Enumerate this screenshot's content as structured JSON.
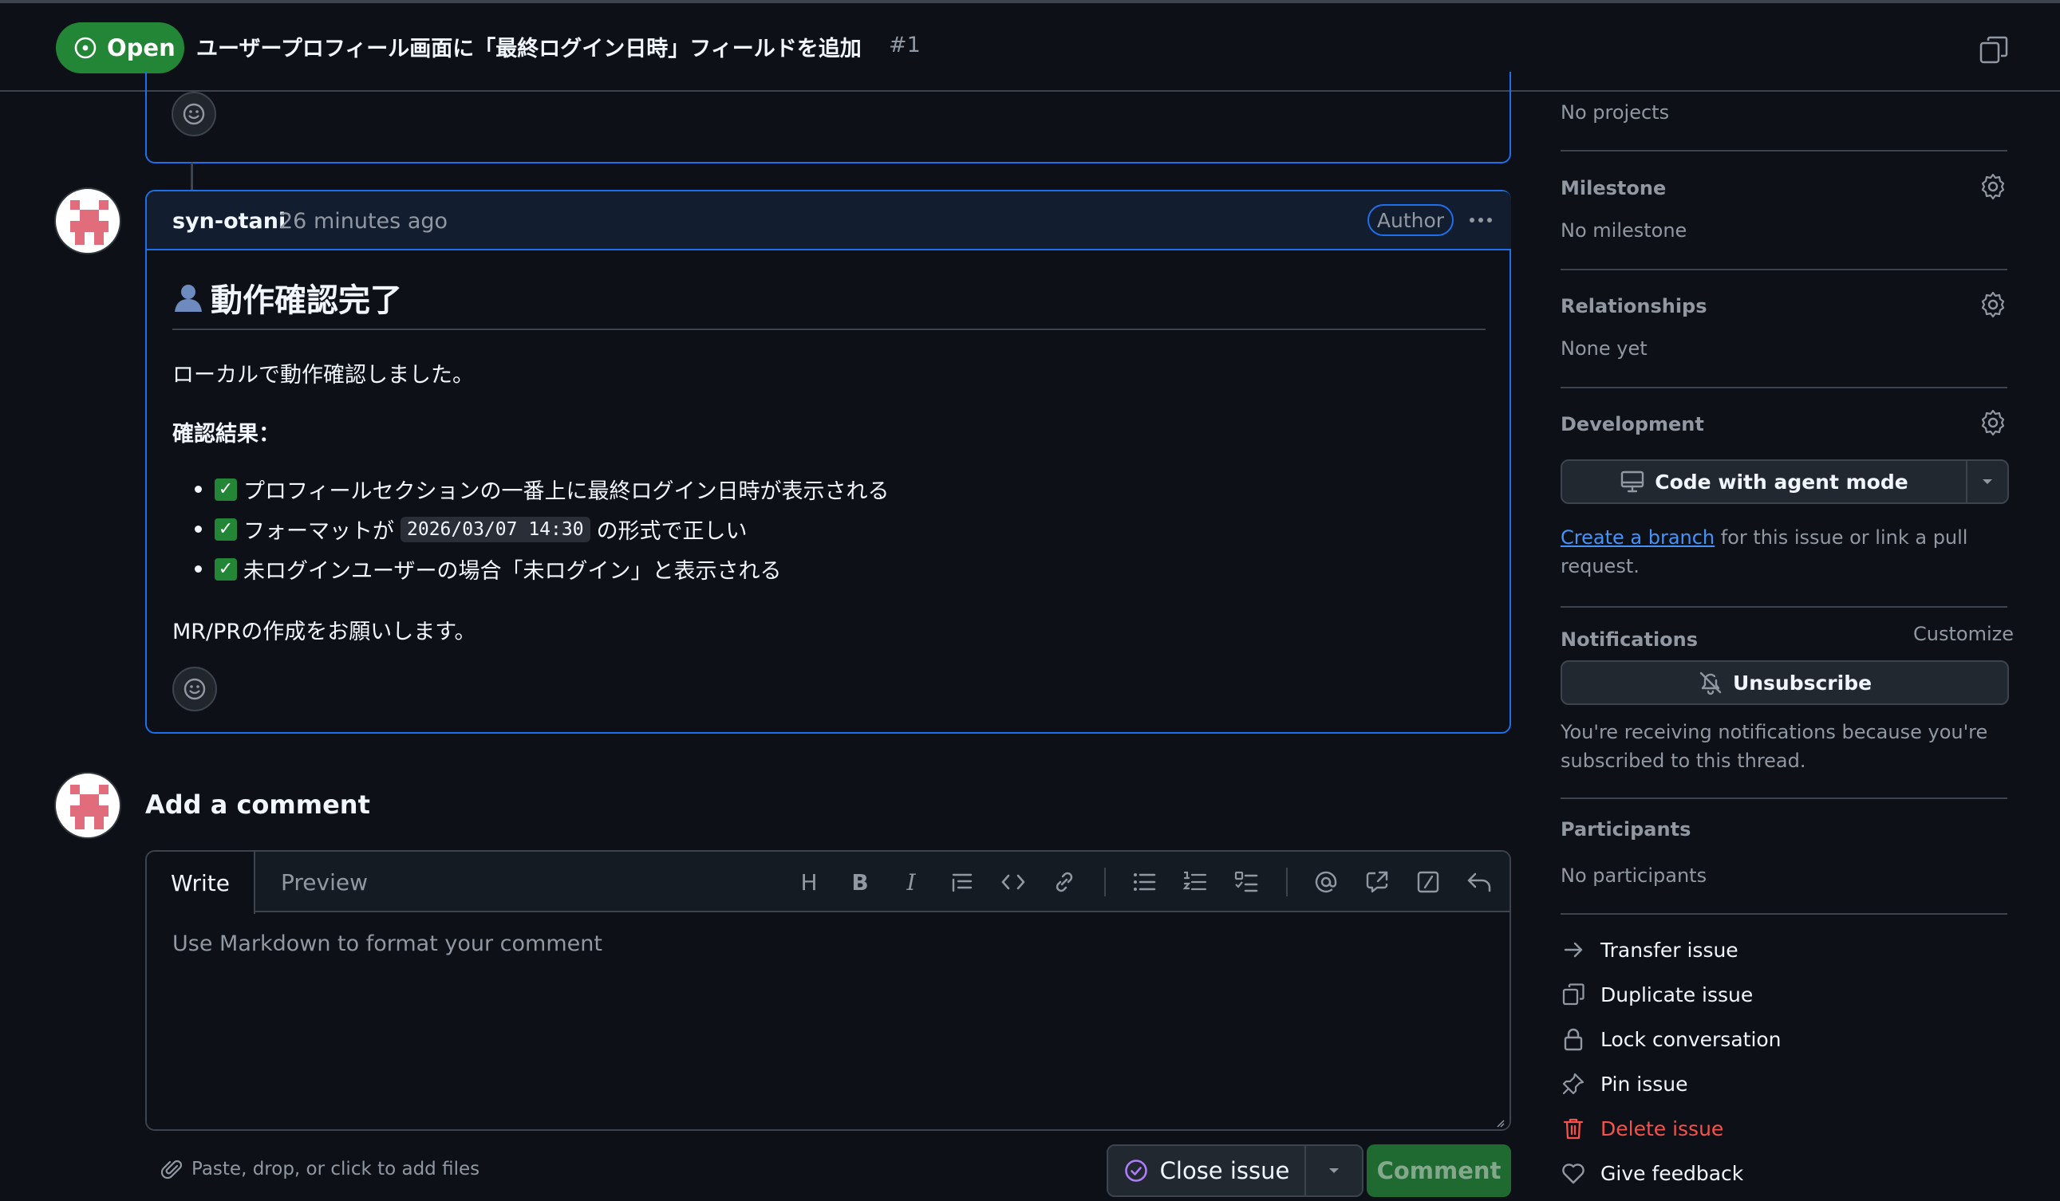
{
  "header": {
    "status": "Open",
    "title": "ユーザープロフィール画面に「最終ログイン日時」フィールドを追加",
    "number": "#1"
  },
  "comment": {
    "user": "syn-otani",
    "time": "26 minutes ago",
    "badge": "Author",
    "heading": "動作確認完了",
    "p1": "ローカルで動作確認しました。",
    "result_label": "確認結果：",
    "items": [
      {
        "text": "プロフィールセクションの一番上に最終ログイン日時が表示される"
      },
      {
        "before": "フォーマットが",
        "code": "2026/03/07 14:30",
        "after": "の形式で正しい"
      },
      {
        "text": "未ログインユーザーの場合「未ログイン」と表示される"
      }
    ],
    "closing": "MR/PRの作成をお願いします。"
  },
  "add_comment": {
    "title": "Add a comment",
    "tab_write": "Write",
    "tab_preview": "Preview",
    "toolbar_heading": "H",
    "toolbar_bold": "B",
    "toolbar_italic": "I",
    "placeholder": "Use Markdown to format your comment",
    "attach": "Paste, drop, or click to add files",
    "close_issue": "Close issue",
    "comment": "Comment"
  },
  "sidebar": {
    "projects_value": "No projects",
    "milestone_label": "Milestone",
    "milestone_value": "No milestone",
    "relationships_label": "Relationships",
    "relationships_value": "None yet",
    "development_label": "Development",
    "agent_button": "Code with agent mode",
    "branch_link": "Create a branch",
    "branch_text_1": " for this issue or link a pull",
    "branch_text_2": "request.",
    "notifications_label": "Notifications",
    "customize": "Customize",
    "unsubscribe": "Unsubscribe",
    "notif_text_1": "You're receiving notifications because you're",
    "notif_text_2": "subscribed to this thread.",
    "participants_label": "Participants",
    "participants_value": "No participants",
    "actions": {
      "transfer": "Transfer issue",
      "duplicate": "Duplicate issue",
      "lock": "Lock conversation",
      "pin": "Pin issue",
      "delete": "Delete issue",
      "feedback": "Give feedback"
    }
  },
  "colors": {
    "open_green": "#238636",
    "accent_blue": "#1f6feb",
    "danger": "#f85149",
    "avatar_pink": "#e06c7c"
  }
}
